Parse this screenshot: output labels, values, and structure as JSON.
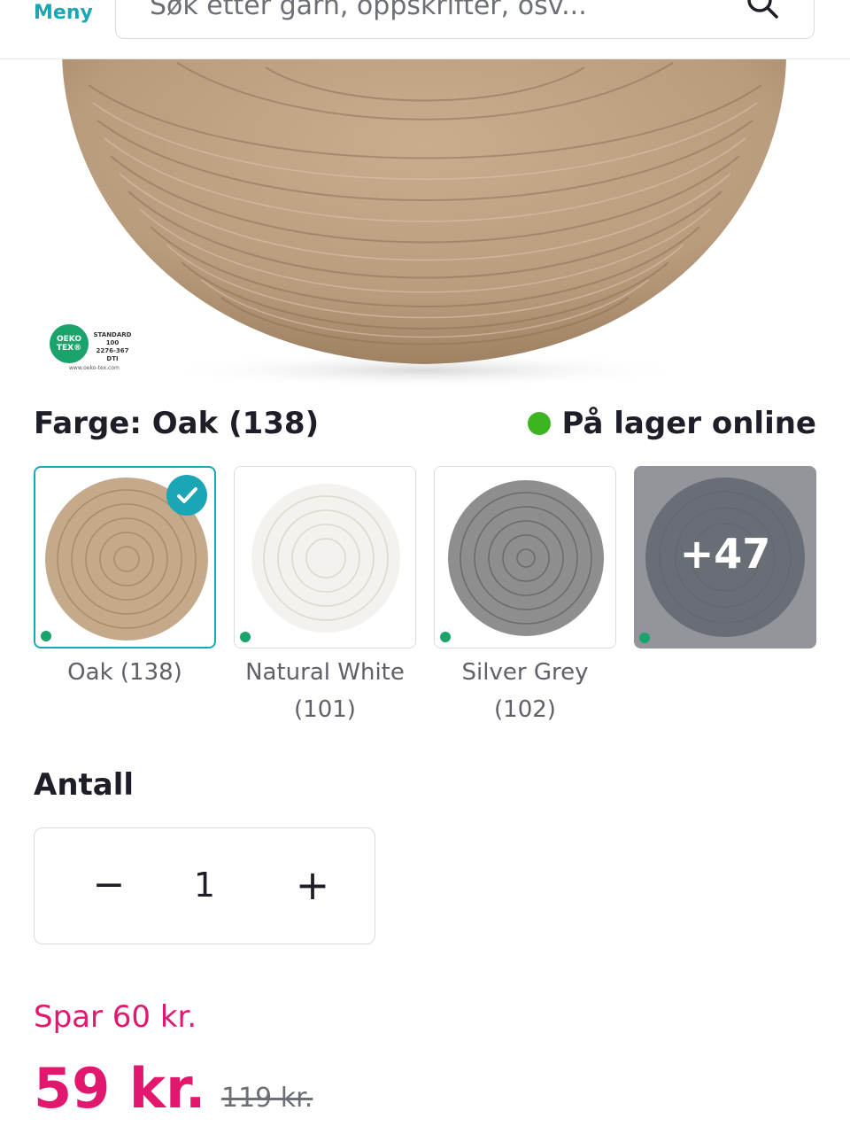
{
  "header": {
    "menu_label": "Meny",
    "search_placeholder": "Søk etter garn, oppskrifter, osv..."
  },
  "hero": {
    "certification": {
      "badge_text": "OEKO TEX®",
      "standard_text": "STANDARD 100",
      "code": "2276-367 DTI",
      "url": "www.oeko-tex.com"
    }
  },
  "color": {
    "heading": "Farge: Oak (138)",
    "stock_status": "På lager online",
    "stock_color": "#3cb521",
    "swatches": [
      {
        "label": "Oak (138)",
        "color": "#c6ab8e",
        "selected": true
      },
      {
        "label": "Natural White (101)",
        "color": "#f3f1ec",
        "selected": false
      },
      {
        "label": "Silver Grey (102)",
        "color": "#8c8c8c",
        "selected": false
      }
    ],
    "more_count": "+47",
    "accent": "#1aa6b4"
  },
  "quantity": {
    "heading": "Antall",
    "value": "1",
    "minus": "−",
    "plus": "+"
  },
  "price": {
    "savings": "Spar 60 kr.",
    "current": "59 kr.",
    "original": "119 kr.",
    "color": "#e2186f"
  }
}
